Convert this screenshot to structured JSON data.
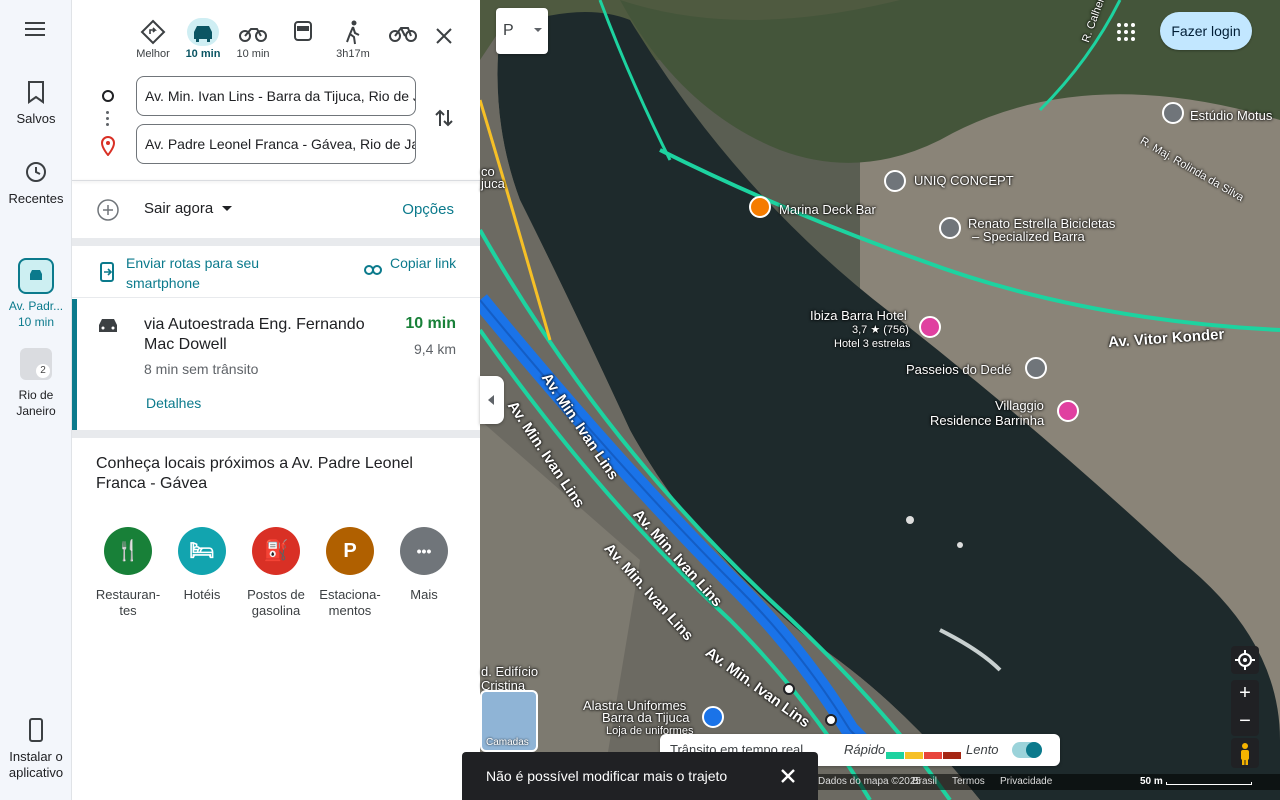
{
  "rail": {
    "saved": "Salvos",
    "recent": "Recentes",
    "route_title": "Av. Padr...",
    "route_time": "10 min",
    "rio": "Rio de Janeiro",
    "rio_count": "2",
    "install": "Instalar o aplicativo"
  },
  "modes": [
    {
      "icon": "diamond-directions-icon",
      "label": "Melhor"
    },
    {
      "icon": "car-icon",
      "label": "10 min"
    },
    {
      "icon": "motorcycle-icon",
      "label": "10 min"
    },
    {
      "icon": "bus-icon",
      "label": ""
    },
    {
      "icon": "walk-icon",
      "label": "3h17m"
    },
    {
      "icon": "bike-icon",
      "label": ""
    }
  ],
  "directions": {
    "origin": "Av. Min. Ivan Lins - Barra da Tijuca, Rio de Janeiro",
    "destination": "Av. Padre Leonel Franca - Gávea, Rio de Janeiro",
    "depart": "Sair agora",
    "options": "Opções"
  },
  "send": {
    "phone": "Enviar rotas para seu smartphone",
    "copy": "Copiar link"
  },
  "route": {
    "via": "via Autoestrada Eng. Fernando Mac Dowell",
    "time": "10 min",
    "distance": "9,4 km",
    "no_traffic": "8 min sem trânsito",
    "details": "Detalhes"
  },
  "nearby": {
    "title": "Conheça locais próximos a Av. Padre Leonel Franca - Gávea",
    "categories": [
      {
        "label": "Restauran-tes",
        "icon": "fork-knife-icon",
        "color": "#188038",
        "glyph": "🍴"
      },
      {
        "label": "Hotéis",
        "icon": "bed-icon",
        "color": "#12a4af",
        "glyph": "🛏"
      },
      {
        "label": "Postos de gasolina",
        "icon": "fuel-icon",
        "color": "#d93025",
        "glyph": "⛽"
      },
      {
        "label": "Estaciona-mentos",
        "icon": "parking-icon",
        "color": "#b06000",
        "glyph": "P"
      },
      {
        "label": "Mais",
        "icon": "more-icon",
        "color": "#70757a",
        "glyph": "•••"
      }
    ]
  },
  "map": {
    "login": "Fazer login",
    "labels": {
      "estudio": "Estúdio Motus",
      "uniq": "UNIQ CONCEPT",
      "marina": "Marina Deck Bar",
      "renato1": "Renato Estrella Bicicletas",
      "renato2": "– Specialized Barra",
      "ibiza": "Ibiza Barra Hotel",
      "ibiza_rating": "3,7 ★ (756)",
      "ibiza_type": "Hotel 3 estrelas",
      "passeios": "Passeios do Dedé",
      "villaggio1": "Villaggio",
      "villaggio2": "Residence Barrinha",
      "vitor": "Av. Vitor Konder",
      "calheiros": "R. Calheiros",
      "rolinda": "R. Maj. Rolinda da Silva",
      "ivan1": "Av. Min. Ivan Lins",
      "ivan2": "Av. Min. Ivan Lins",
      "ivan3": "Av. Min. Ivan Lins",
      "ivan4": "Av. Min. Ivan Lins",
      "ivan5": "Av. Min. Ivan Lins",
      "alastra1": "Alastra Uniformes",
      "alastra2": "Barra da Tijuca",
      "alastra3": "Loja de uniformes",
      "edificio": "d. Edifício",
      "cristina": "Cristina",
      "tijuca": "co",
      "tijuca2": "juca"
    },
    "layers": "Camadas",
    "traffic": {
      "realtime": "Trânsito em tempo real",
      "fast": "Rápido",
      "slow": "Lento",
      "colors": [
        "#1dd3a0",
        "#f6c026",
        "#e8453c",
        "#a52714"
      ]
    },
    "footer": {
      "data": "Dados do mapa ©2025",
      "country": "Brasil",
      "terms": "Termos",
      "privacy": "Privacidade",
      "scale": "50 m"
    }
  },
  "toast": "Não é possível modificar mais o trajeto"
}
